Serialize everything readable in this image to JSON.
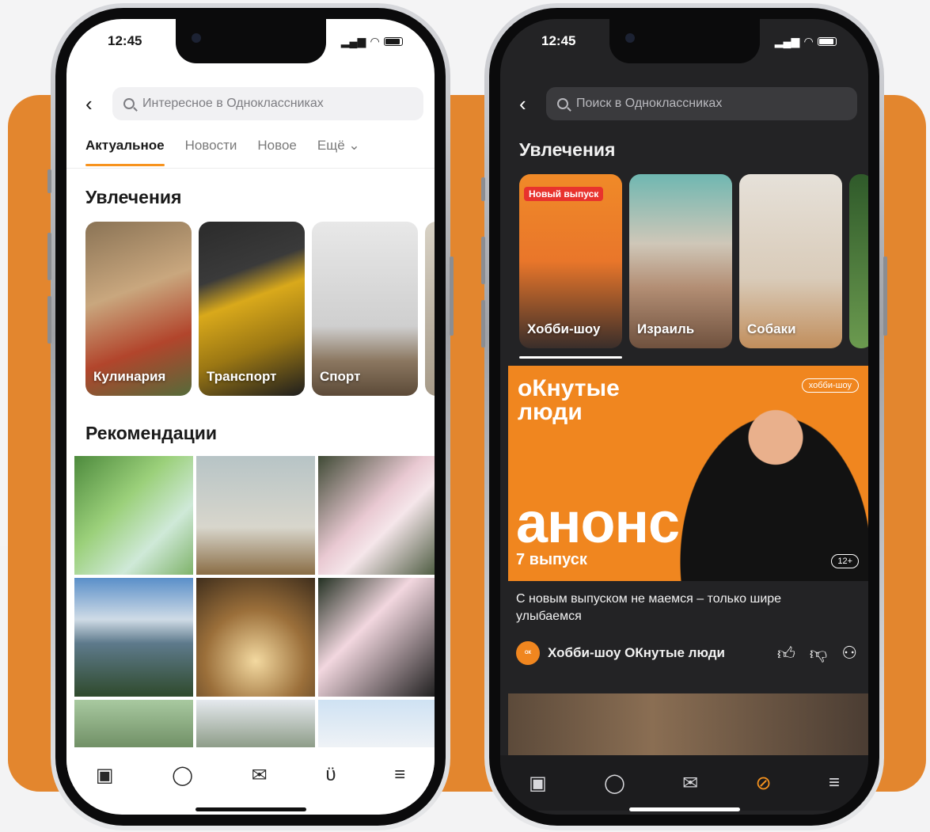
{
  "status_bar": {
    "time": "12:45"
  },
  "left_phone": {
    "search_placeholder": "Интересное в Одноклассниках",
    "tabs": [
      "Актуальное",
      "Новости",
      "Новое",
      "Ещё ⌄"
    ],
    "hobbies_title": "Увлечения",
    "hobbies": [
      {
        "label": "Кулинария"
      },
      {
        "label": "Транспорт"
      },
      {
        "label": "Спорт"
      }
    ],
    "recommendations_title": "Рекомендации",
    "nav_icons": [
      "feed-icon",
      "discussions-icon",
      "messages-icon",
      "hobby-icon",
      "menu-icon"
    ]
  },
  "right_phone": {
    "search_placeholder": "Поиск в Одноклассниках",
    "hobbies_title": "Увлечения",
    "hobbies": [
      {
        "label": "Хобби-шоу",
        "badge": "Новый выпуск"
      },
      {
        "label": "Израиль"
      },
      {
        "label": "Собаки"
      }
    ],
    "promo": {
      "brand_line1": "оКнутые",
      "brand_line2": "люди",
      "tag": "хобби-шоу",
      "big_text": "анонс",
      "episode": "7 выпуск",
      "age": "12+"
    },
    "caption": "С новым выпуском не маемся – только шире улыбаемся",
    "author": "Хобби-шоу ОКнутые люди",
    "nav_icons": [
      "feed-icon",
      "discussions-icon",
      "messages-icon",
      "explore-icon",
      "menu-icon"
    ]
  },
  "colors": {
    "accent": "#f7931e",
    "background_orange": "#e3862e",
    "dark_screen": "#232325"
  }
}
